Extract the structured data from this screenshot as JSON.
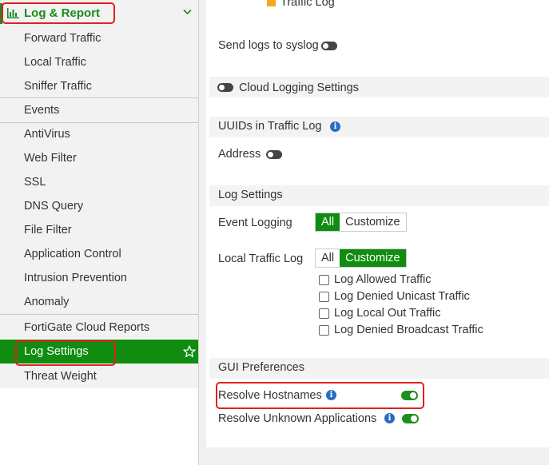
{
  "sidebar": {
    "section_title": "Log & Report",
    "items": [
      {
        "label": "Forward Traffic"
      },
      {
        "label": "Local Traffic"
      },
      {
        "label": "Sniffer Traffic"
      },
      {
        "label": "Events"
      },
      {
        "label": "AntiVirus"
      },
      {
        "label": "Web Filter"
      },
      {
        "label": "SSL"
      },
      {
        "label": "DNS Query"
      },
      {
        "label": "File Filter"
      },
      {
        "label": "Application Control"
      },
      {
        "label": "Intrusion Prevention"
      },
      {
        "label": "Anomaly"
      },
      {
        "label": "FortiGate Cloud Reports"
      },
      {
        "label": "Log Settings",
        "active": true
      },
      {
        "label": "Threat Weight"
      }
    ]
  },
  "main": {
    "legend_label": "Traffic Log",
    "send_syslog_label": "Send logs to syslog",
    "send_syslog_enabled": false,
    "cloud_logging_label": "Cloud Logging Settings",
    "cloud_logging_enabled": false,
    "uuids_section": "UUIDs in Traffic Log",
    "address_label": "Address",
    "address_enabled": false,
    "log_settings_section": "Log Settings",
    "event_logging_label": "Event Logging",
    "event_logging_options": [
      "All",
      "Customize"
    ],
    "event_logging_selected": "All",
    "local_traffic_label": "Local Traffic Log",
    "local_traffic_options": [
      "All",
      "Customize"
    ],
    "local_traffic_selected": "Customize",
    "local_traffic_checkboxes": [
      {
        "label": "Log Allowed Traffic",
        "checked": false
      },
      {
        "label": "Log Denied Unicast Traffic",
        "checked": false
      },
      {
        "label": "Log Local Out Traffic",
        "checked": false
      },
      {
        "label": "Log Denied Broadcast Traffic",
        "checked": false
      }
    ],
    "gui_section": "GUI Preferences",
    "resolve_hostnames_label": "Resolve Hostnames",
    "resolve_hostnames_enabled": true,
    "resolve_apps_label": "Resolve Unknown Applications",
    "resolve_apps_enabled": true
  },
  "colors": {
    "accent": "#108c10",
    "highlight": "#e02020",
    "info": "#2a6cc4",
    "legend": "#f5a623"
  }
}
